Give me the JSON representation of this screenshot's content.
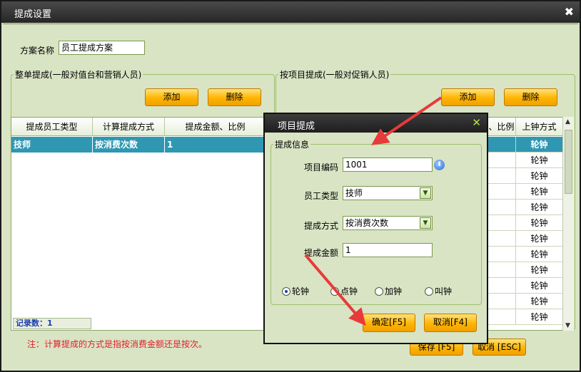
{
  "window": {
    "title": "提成设置",
    "close": "✖"
  },
  "scheme": {
    "label": "方案名称",
    "value": "员工提成方案"
  },
  "left_group": {
    "title": "整单提成(一般对值台和营销人员)",
    "add": "添加",
    "delete": "删除",
    "columns": [
      "提成员工类型",
      "计算提成方式",
      "提成金额、比例"
    ],
    "rows": [
      {
        "type": "技师",
        "method": "按消费次数",
        "amount": "1"
      }
    ],
    "record_count": "记录数：1"
  },
  "right_group": {
    "title": "按项目提成(一般对促销人员)",
    "add": "添加",
    "delete": "删除",
    "col_ratio": "、比例",
    "col_clock": "上钟方式",
    "clock_values": [
      "轮钟",
      "轮钟",
      "轮钟",
      "轮钟",
      "轮钟",
      "轮钟",
      "轮钟",
      "轮钟",
      "轮钟",
      "轮钟",
      "轮钟",
      "轮钟"
    ]
  },
  "note": "注：计算提成的方式是指按消费金额还是按次。",
  "bottom_buttons": {
    "save": "保存 [F5]",
    "cancel": "取消 [ESC]"
  },
  "dialog": {
    "title": "项目提成",
    "close": "✕",
    "group_title": "提成信息",
    "code_label": "项目编码",
    "code_value": "1001",
    "emp_label": "员工类型",
    "emp_value": "技师",
    "method_label": "提成方式",
    "method_value": "按消费次数",
    "amount_label": "提成金额",
    "amount_value": "1",
    "radios": [
      "轮钟",
      "点钟",
      "加钟",
      "叫钟"
    ],
    "radio_selected": "轮钟",
    "ok": "确定[F5]",
    "cancel": "取消[F4]"
  },
  "colors": {
    "accent_arrow": "#e83a3a",
    "selection": "#2f97b2"
  }
}
